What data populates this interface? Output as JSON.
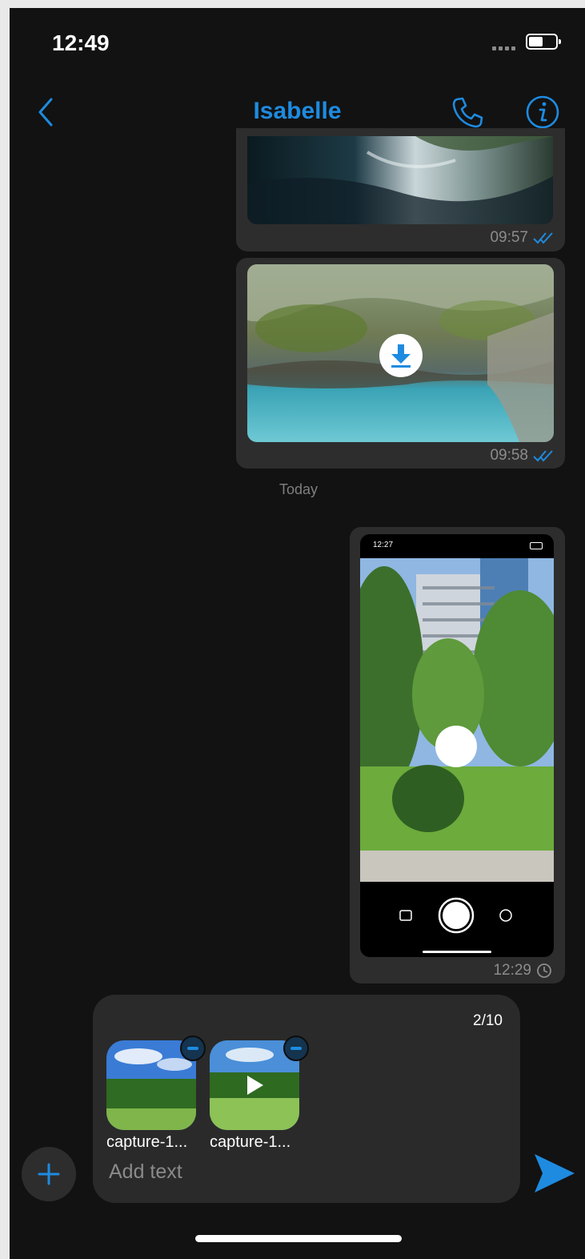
{
  "status_bar": {
    "time": "12:49"
  },
  "header": {
    "contact_name": "Isabelle"
  },
  "messages": [
    {
      "time": "09:57",
      "status": "read"
    },
    {
      "time": "09:58",
      "status": "read"
    },
    {
      "time": "12:29",
      "status": "pending",
      "inner_screenshot_time": "12:27"
    }
  ],
  "date_separator": "Today",
  "composer": {
    "counter": "2/10",
    "attachments": [
      {
        "name": "capture-1...",
        "type": "image"
      },
      {
        "name": "capture-1...",
        "type": "video"
      }
    ],
    "placeholder": "Add text"
  },
  "colors": {
    "accent": "#1e8be0",
    "background": "#121212",
    "bubble": "#2d2d2d"
  },
  "icons": [
    "back-chevron-icon",
    "phone-icon",
    "info-icon",
    "download-icon",
    "double-check-icon",
    "clock-icon",
    "minus-icon",
    "play-icon",
    "plus-icon",
    "send-icon"
  ]
}
